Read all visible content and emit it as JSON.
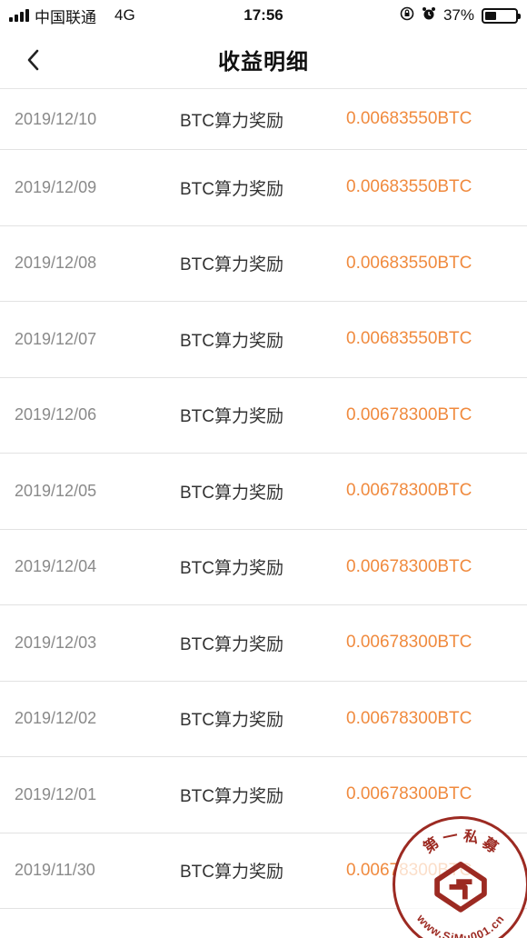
{
  "status_bar": {
    "carrier": "中国联通",
    "network": "4G",
    "time": "17:56",
    "battery_percent": "37%",
    "battery_level": 0.37
  },
  "header": {
    "title": "收益明细"
  },
  "rows": [
    {
      "date": "2019/12/10",
      "desc": "BTC算力奖励",
      "amount": "0.00683550BTC"
    },
    {
      "date": "2019/12/09",
      "desc": "BTC算力奖励",
      "amount": "0.00683550BTC"
    },
    {
      "date": "2019/12/08",
      "desc": "BTC算力奖励",
      "amount": "0.00683550BTC"
    },
    {
      "date": "2019/12/07",
      "desc": "BTC算力奖励",
      "amount": "0.00683550BTC"
    },
    {
      "date": "2019/12/06",
      "desc": "BTC算力奖励",
      "amount": "0.00678300BTC"
    },
    {
      "date": "2019/12/05",
      "desc": "BTC算力奖励",
      "amount": "0.00678300BTC"
    },
    {
      "date": "2019/12/04",
      "desc": "BTC算力奖励",
      "amount": "0.00678300BTC"
    },
    {
      "date": "2019/12/03",
      "desc": "BTC算力奖励",
      "amount": "0.00678300BTC"
    },
    {
      "date": "2019/12/02",
      "desc": "BTC算力奖励",
      "amount": "0.00678300BTC"
    },
    {
      "date": "2019/12/01",
      "desc": "BTC算力奖励",
      "amount": "0.00678300BTC"
    },
    {
      "date": "2019/11/30",
      "desc": "BTC算力奖励",
      "amount": "0.00678300BTC"
    }
  ],
  "watermark": {
    "text_top": "第 一 私 募",
    "text_bottom": "www.SiMu001.cn"
  },
  "colors": {
    "amount": "#f08a3e",
    "date": "#8a8a8a",
    "watermark": "#9c2a22"
  },
  "icons": {
    "back": "chevron-left-icon",
    "lock": "rotation-lock-icon",
    "alarm": "alarm-icon"
  }
}
